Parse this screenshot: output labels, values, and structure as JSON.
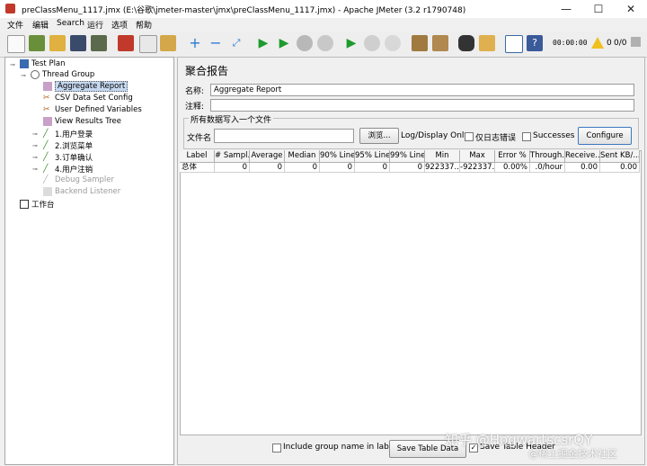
{
  "window": {
    "title": "preClassMenu_1117.jmx (E:\\谷歌\\jmeter-master\\jmx\\preClassMenu_1117.jmx) - Apache JMeter (3.2 r1790748)",
    "minimize": "—",
    "maximize": "☐",
    "close": "✕"
  },
  "menu": [
    "文件",
    "编辑",
    "Search",
    "运行",
    "选项",
    "帮助"
  ],
  "toolbar": {
    "timer": "00:00:00",
    "warning_count": "0",
    "ratio": "0/0"
  },
  "tree": {
    "test_plan": "Test Plan",
    "thread_group": "Thread Group",
    "items": [
      {
        "label": "Aggregate Report",
        "icon": "chart-icon"
      },
      {
        "label": "CSV Data Set Config",
        "icon": "scissors-icon"
      },
      {
        "label": "User Defined Variables",
        "icon": "scissors-icon"
      },
      {
        "label": "View Results Tree",
        "icon": "chart-icon"
      },
      {
        "label": "1.用户登录",
        "icon": "pipette-icon"
      },
      {
        "label": "2.浏览菜单",
        "icon": "pipette-icon"
      },
      {
        "label": "3.订单确认",
        "icon": "pipette-icon"
      },
      {
        "label": "4.用户注销",
        "icon": "pipette-icon"
      },
      {
        "label": "Debug Sampler",
        "icon": "pipette-icon"
      },
      {
        "label": "Backend Listener",
        "icon": "chart-icon"
      }
    ],
    "workbench": "工作台"
  },
  "panel": {
    "heading": "聚合报告",
    "name_label": "名称:",
    "name_value": "Aggregate Report",
    "comment_label": "注释:",
    "comment_value": "",
    "file_group_title": "所有数据写入一个文件",
    "filename_label": "文件名",
    "filename_value": "",
    "browse_button": "浏览...",
    "log_display_label": "Log/Display Only:",
    "errors_only_label": "仅日志错误",
    "successes_label": "Successes",
    "configure_button": "Configure"
  },
  "table": {
    "headers": [
      "Label",
      "# Sampl...",
      "Average",
      "Median",
      "90% Line",
      "95% Line",
      "99% Line",
      "Min",
      "Max",
      "Error %",
      "Through...",
      "Receive...",
      "Sent KB/..."
    ],
    "rows": [
      [
        "总体",
        "0",
        "0",
        "0",
        "0",
        "0",
        "0",
        "922337...",
        "-922337...",
        "0.00%",
        ".0/hour",
        "0.00",
        "0.00"
      ]
    ]
  },
  "bottom": {
    "include_group_label": "Include group name in label?",
    "save_table_button": "Save Table Data",
    "save_header_label": "Save Table Header"
  },
  "watermark": {
    "line1": "知乎 @HogwartscsrQY",
    "line2": "@稀土掘金技术社区"
  }
}
